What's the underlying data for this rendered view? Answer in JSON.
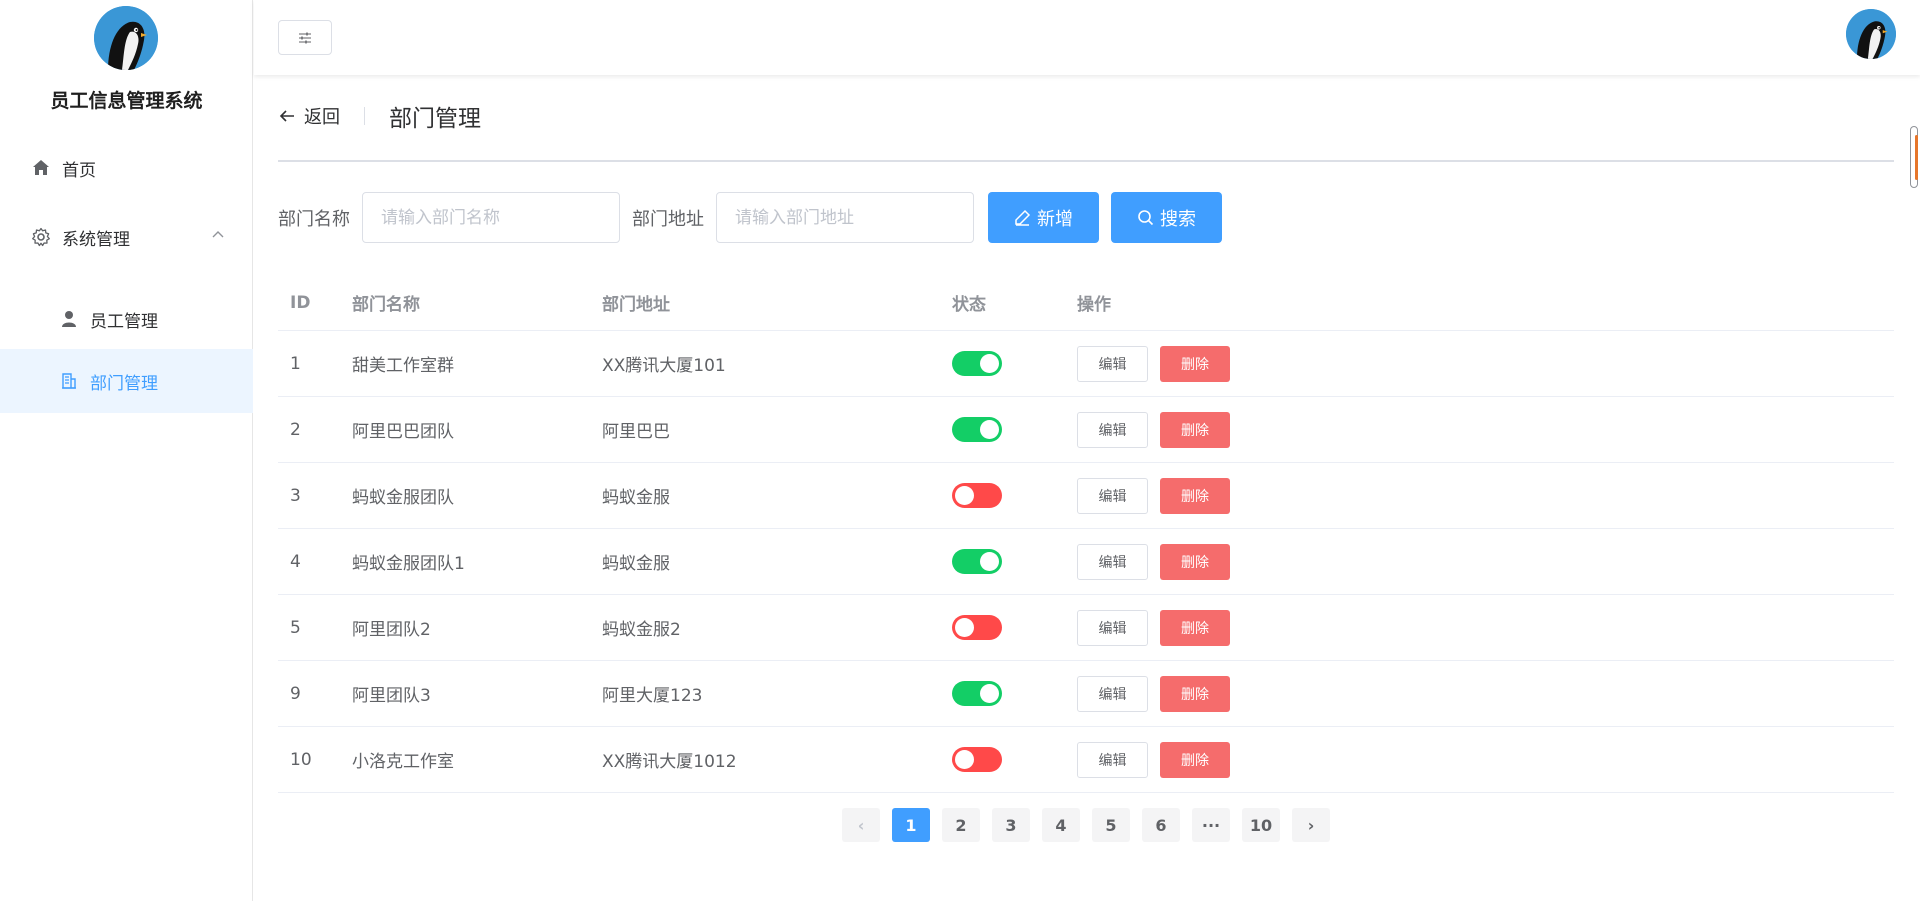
{
  "app": {
    "title": "员工信息管理系统"
  },
  "sidebar": {
    "items": [
      {
        "label": "首页",
        "icon": "home-icon"
      },
      {
        "label": "系统管理",
        "icon": "gear-icon"
      },
      {
        "label": "员工管理",
        "icon": "user-icon"
      },
      {
        "label": "部门管理",
        "icon": "building-icon"
      }
    ]
  },
  "page": {
    "back_label": "返回",
    "title": "部门管理"
  },
  "search": {
    "name_label": "部门名称",
    "name_placeholder": "请输入部门名称",
    "addr_label": "部门地址",
    "addr_placeholder": "请输入部门地址",
    "add_label": "新增",
    "search_label": "搜索"
  },
  "table": {
    "columns": [
      "ID",
      "部门名称",
      "部门地址",
      "状态",
      "操作"
    ],
    "edit_label": "编辑",
    "delete_label": "删除",
    "rows": [
      {
        "id": "1",
        "name": "甜美工作室群",
        "addr": "XX腾讯大厦101",
        "enabled": true
      },
      {
        "id": "2",
        "name": "阿里巴巴团队",
        "addr": "阿里巴巴",
        "enabled": true
      },
      {
        "id": "3",
        "name": "蚂蚁金服团队",
        "addr": "蚂蚁金服",
        "enabled": false
      },
      {
        "id": "4",
        "name": "蚂蚁金服团队1",
        "addr": "蚂蚁金服",
        "enabled": true
      },
      {
        "id": "5",
        "name": "阿里团队2",
        "addr": "蚂蚁金服2",
        "enabled": false
      },
      {
        "id": "9",
        "name": "阿里团队3",
        "addr": "阿里大厦123",
        "enabled": true
      },
      {
        "id": "10",
        "name": "小洛克工作室",
        "addr": "XX腾讯大厦1012",
        "enabled": false
      }
    ]
  },
  "pagination": {
    "prev": "‹",
    "pages": [
      "1",
      "2",
      "3",
      "4",
      "5",
      "6",
      "···",
      "10"
    ],
    "current": "1",
    "next": "›"
  },
  "colors": {
    "primary": "#409eff",
    "danger": "#f56c6c",
    "switch_on": "#13ce66",
    "switch_off": "#ff4949"
  }
}
